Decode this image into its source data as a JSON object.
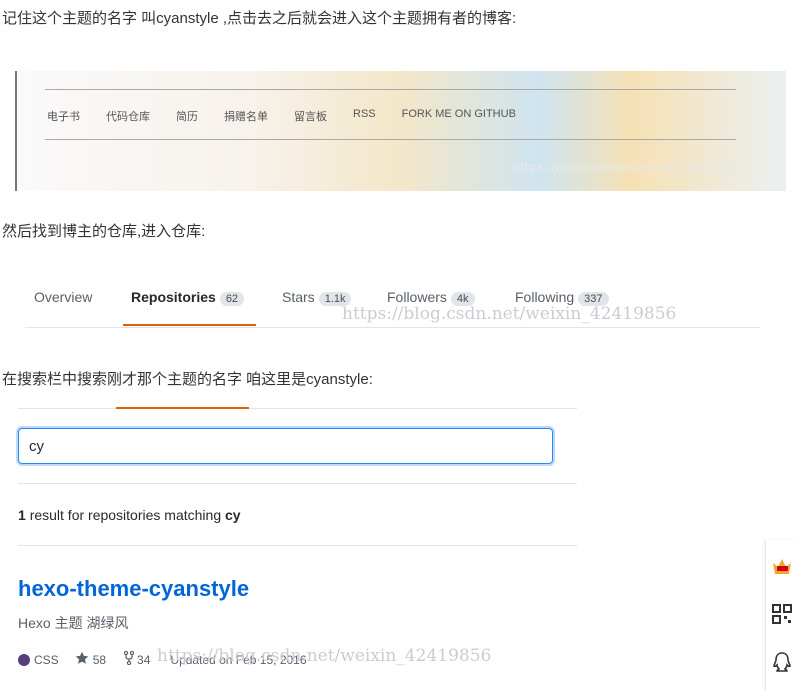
{
  "intro_text": "记住这个主题的名字 叫cyanstyle ,点击去之后就会进入这个主题拥有者的博客:",
  "banner_nav": [
    "电子书",
    "代码仓库",
    "简历",
    "捐赠名单",
    "留言板",
    "RSS",
    "FORK ME ON GITHUB"
  ],
  "watermark": "https://blog.csdn.net/weixin_42419856",
  "text_repo": "然后找到博主的仓库,进入仓库:",
  "tabs": [
    {
      "label": "Overview",
      "count": ""
    },
    {
      "label": "Repositories",
      "count": "62"
    },
    {
      "label": "Stars",
      "count": "1.1k"
    },
    {
      "label": "Followers",
      "count": "4k"
    },
    {
      "label": "Following",
      "count": "337"
    }
  ],
  "text_search": "在搜索栏中搜索刚才那个主题的名字 咱这里是cyanstyle:",
  "search": {
    "value": "cy",
    "placeholder": ""
  },
  "result": {
    "count": "1",
    "text": "result for repositories matching",
    "query": "cy"
  },
  "repo": {
    "name": "hexo-theme-cyanstyle",
    "description": "Hexo 主题 湖绿风",
    "language": "CSS",
    "language_color": "#563d7c",
    "stars": "58",
    "forks": "34",
    "updated": "Updated on Feb 15, 2016"
  },
  "sidebar_icons": [
    "vip-crown-icon",
    "qr-code-icon",
    "qq-icon"
  ]
}
